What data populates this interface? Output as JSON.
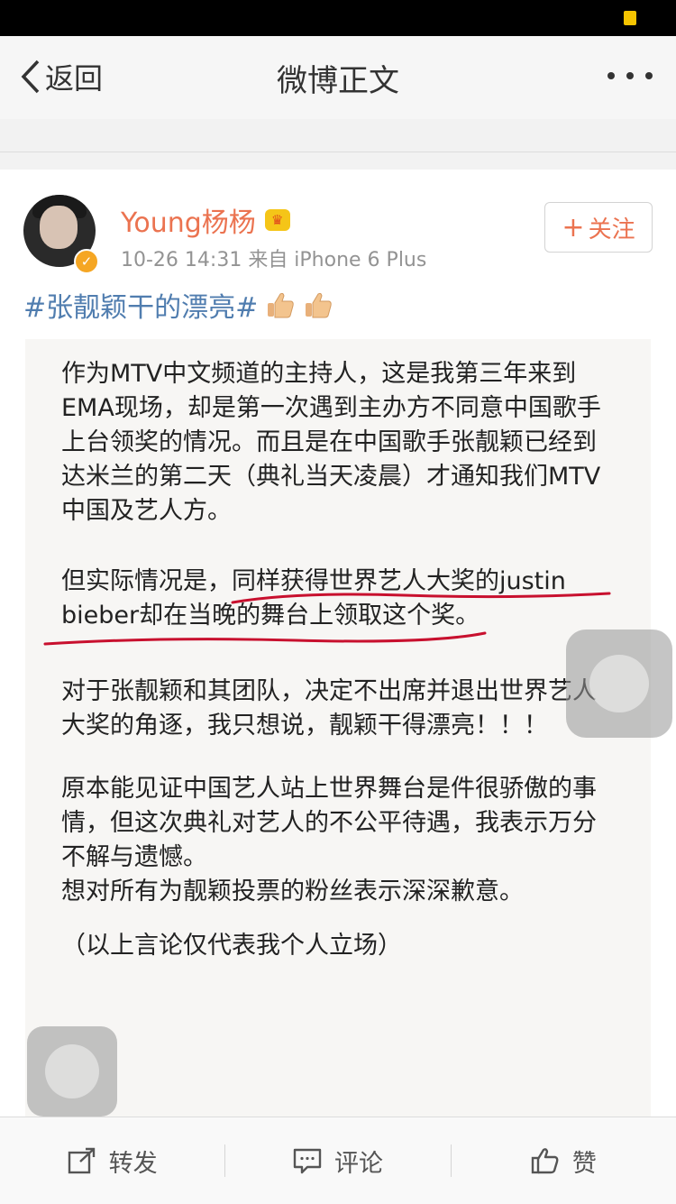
{
  "nav": {
    "back_label": "返回",
    "title": "微博正文"
  },
  "post": {
    "username": "Young杨杨",
    "meta": "10-26 14:31  来自 iPhone 6 Plus",
    "follow_label": "关注",
    "hashtag": "#张靓颖干的漂亮#",
    "body": {
      "p1": "作为MTV中文频道的主持人，这是我第三年来到EMA现场，却是第一次遇到主办方不同意中国歌手上台领奖的情况。而且是在中国歌手张靓颖已经到达米兰的第二天（典礼当天凌晨）才通知我们MTV中国及艺人方。",
      "p2": "但实际情况是，同样获得世界艺人大奖的justin bieber却在当晚的舞台上领取这个奖。",
      "p3": "对于张靓颖和其团队，决定不出席并退出世界艺人大奖的角逐，我只想说，靓颖干得漂亮！！！",
      "p4": "原本能见证中国艺人站上世界舞台是件很骄傲的事情，但这次典礼对艺人的不公平待遇，我表示万分不解与遗憾。\n想对所有为靓颖投票的粉丝表示深深歉意。",
      "p5": "（以上言论仅代表我个人立场）"
    }
  },
  "tabbar": {
    "repost_label": "转发",
    "comment_label": "评论",
    "like_label": "赞"
  },
  "icons": {
    "back": "chevron-left-icon",
    "more": "more-dots-icon",
    "verified": "verified-badge-icon",
    "vip": "vip-crown-icon",
    "thumbs": "thumbs-up-emoji-icon",
    "repost": "repost-icon",
    "comment": "comment-icon",
    "like": "like-icon"
  },
  "colors": {
    "username": "#eb7350",
    "hashtag": "#507daf",
    "underline": "#c8102e"
  }
}
